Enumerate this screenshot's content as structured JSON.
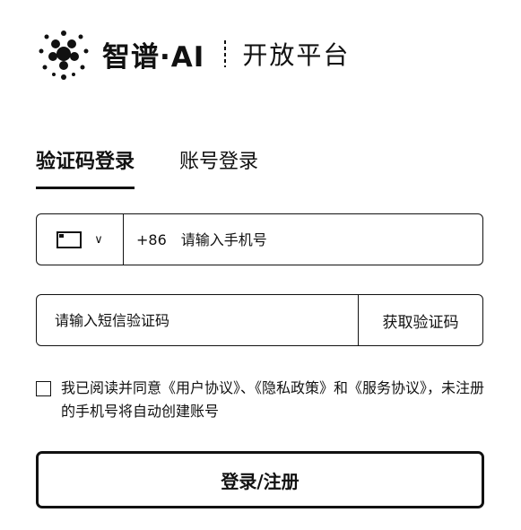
{
  "brand": {
    "name": "智谱·AI",
    "subtitle": "开放平台",
    "logo_icon": "zhipu-dot-logo-icon"
  },
  "tabs": [
    {
      "label": "验证码登录",
      "active": true
    },
    {
      "label": "账号登录",
      "active": false
    }
  ],
  "phone": {
    "country_icon": "flag-icon",
    "prefix": "+86",
    "placeholder": "请输入手机号"
  },
  "code": {
    "placeholder": "请输入短信验证码",
    "button_label": "获取验证码"
  },
  "agreement": {
    "text_html_segments": "我已阅读并同意《用户协议》、《隐私政策》和《服务协议》，未注册的手机号将自动创建账号"
  },
  "submit": {
    "label": "登录/注册"
  }
}
